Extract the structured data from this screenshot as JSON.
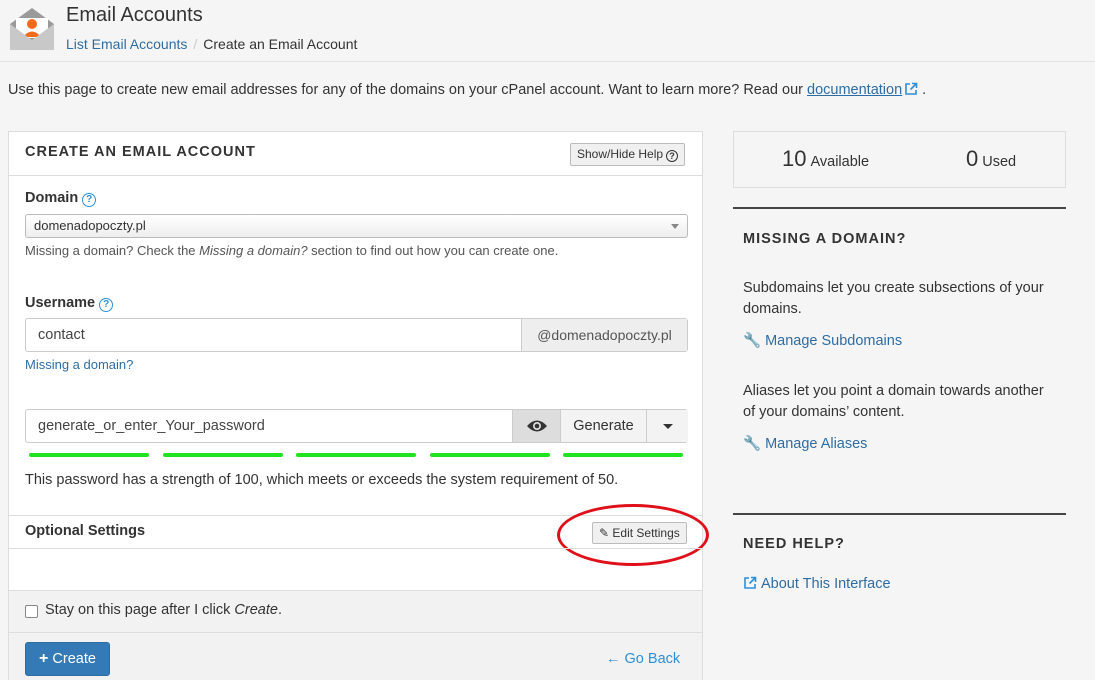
{
  "header": {
    "title": "Email Accounts",
    "breadcrumb": {
      "link": "List Email Accounts",
      "separator": "/",
      "current": "Create an Email Account"
    }
  },
  "intro": {
    "text": "Use this page to create new email addresses for any of the domains on your cPanel account. Want to learn more? Read our ",
    "link": "documentation",
    "end": "."
  },
  "form": {
    "heading": "CREATE AN EMAIL ACCOUNT",
    "help_button": "Show/Hide Help",
    "domain": {
      "label": "Domain",
      "value": "domenadopoczty.pl",
      "help_prefix": "Missing a domain? Check the ",
      "help_italic": "Missing a domain?",
      "help_suffix": " section to find out how you can create one."
    },
    "username": {
      "label": "Username",
      "value": "contact",
      "suffix": "@domenadopoczty.pl",
      "missing_link": "Missing a domain?"
    },
    "password": {
      "value": "generate_or_enter_Your_password",
      "generate_label": "Generate",
      "strength_percent": 100,
      "strength_color": "#21e221",
      "strength_text": "This password has a strength of 100, which meets or exceeds the system requirement of 50."
    },
    "optional_settings": {
      "label": "Optional Settings",
      "edit_button": "Edit Settings"
    },
    "stay_label_prefix": "Stay on this page after I click ",
    "stay_label_italic": "Create",
    "stay_label_suffix": ".",
    "create_button": "Create",
    "go_back": "Go Back"
  },
  "sidebar": {
    "available": {
      "count": "10",
      "label": "Available"
    },
    "used": {
      "count": "0",
      "label": "Used"
    },
    "missing_domain": {
      "heading": "MISSING A DOMAIN?",
      "subdomains_text": "Subdomains let you create subsections of your domains.",
      "subdomains_link": "Manage Subdomains",
      "aliases_text": "Aliases let you point a domain towards another of your domains’ content.",
      "aliases_link": "Manage Aliases"
    },
    "need_help": {
      "heading": "NEED HELP?",
      "link": "About This Interface"
    }
  },
  "colors": {
    "accent": "#337ab7",
    "link": "#2e6da4",
    "highlight": "#e0101a"
  }
}
